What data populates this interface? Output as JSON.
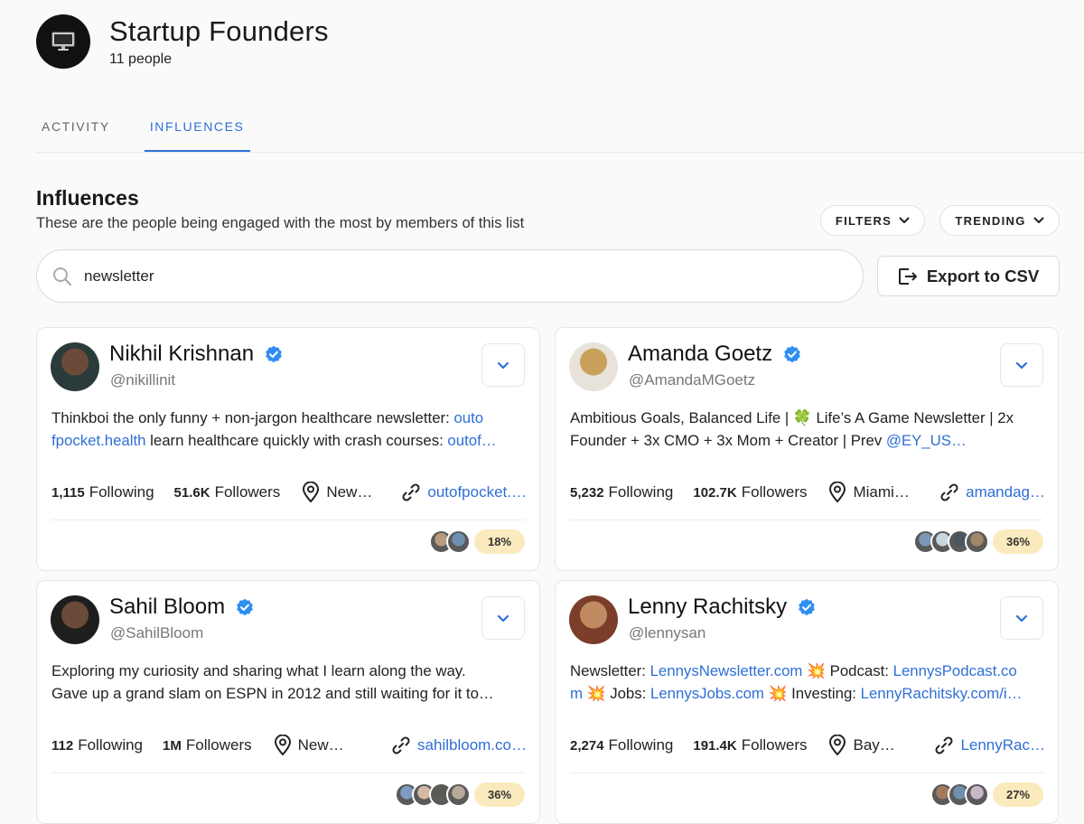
{
  "group": {
    "title": "Startup Founders",
    "count": "11 people",
    "icon": "monitor-icon"
  },
  "tabs": [
    {
      "label": "ACTIVITY",
      "active": false
    },
    {
      "label": "INFLUENCES",
      "active": true
    }
  ],
  "section": {
    "title": "Influences",
    "subtitle": "These are the people being engaged with the most by members of this list"
  },
  "controls": {
    "filters_label": "FILTERS",
    "trending_label": "TRENDING",
    "export_label": "Export to CSV"
  },
  "search": {
    "value": "newsletter",
    "placeholder": ""
  },
  "colors": {
    "accent": "#2f6fd6",
    "verified": "#2f8ef0",
    "pct_badge": "#fbeabd"
  },
  "people": [
    {
      "name": "Nikhil Krishnan",
      "handle": "@nikillinit",
      "bio_line1": [
        {
          "t": "Thinkboi the only funny + non-jargon healthcare newsletter: "
        },
        {
          "t": "outo",
          "link": true
        }
      ],
      "bio_line2": [
        {
          "t": "fpocket.health",
          "link": true
        },
        {
          "t": " learn healthcare quickly with crash courses: "
        },
        {
          "t": "outof…",
          "link": true
        }
      ],
      "following": "1,115",
      "following_label": "Following",
      "followers": "51.6K",
      "followers_label": "Followers",
      "location": "New…",
      "website": "outofpocket.…",
      "percent": "18%",
      "faces": [
        "#b89a7e",
        "#6f8fb0"
      ]
    },
    {
      "name": "Amanda Goetz",
      "handle": "@AmandaMGoetz",
      "bio_line1": [
        {
          "t": "Ambitious Goals, Balanced Life | 🍀 Life’s A Game Newsletter | 2x"
        }
      ],
      "bio_line2": [
        {
          "t": "Founder + 3x CMO + 3x Mom + Creator | Prev "
        },
        {
          "t": "@EY_US…",
          "link": true
        }
      ],
      "following": "5,232",
      "following_label": "Following",
      "followers": "102.7K",
      "followers_label": "Followers",
      "location": "Miami…",
      "website": "amandag…",
      "percent": "36%",
      "faces": [
        "#7d98b5",
        "#c9d6e0",
        "#4a5560",
        "#a08868"
      ]
    },
    {
      "name": "Sahil Bloom",
      "handle": "@SahilBloom",
      "bio_line1": [
        {
          "t": "Exploring my curiosity and sharing what I learn along the way."
        }
      ],
      "bio_line2": [
        {
          "t": "Gave up a grand slam on ESPN in 2012 and still waiting for it to…"
        }
      ],
      "following": "112",
      "following_label": "Following",
      "followers": "1M",
      "followers_label": "Followers",
      "location": "New…",
      "website": "sahilbloom.co…",
      "percent": "36%",
      "faces": [
        "#7f9cc0",
        "#d7b8a4",
        "#5b5a52",
        "#b7aa98"
      ]
    },
    {
      "name": "Lenny Rachitsky",
      "handle": "@lennysan",
      "bio_line1": [
        {
          "t": "Newsletter: "
        },
        {
          "t": "LennysNewsletter.com",
          "link": true
        },
        {
          "t": " 💥 Podcast: "
        },
        {
          "t": "LennysPodcast.co",
          "link": true
        }
      ],
      "bio_line2": [
        {
          "t": "m",
          "link": true
        },
        {
          "t": " 💥 Jobs: "
        },
        {
          "t": "LennysJobs.com",
          "link": true
        },
        {
          "t": " 💥 Investing: "
        },
        {
          "t": "LennyRachitsky.com/i…",
          "link": true
        }
      ],
      "following": "2,274",
      "following_label": "Following",
      "followers": "191.4K",
      "followers_label": "Followers",
      "location": "Bay…",
      "website": "LennyRac…",
      "percent": "27%",
      "faces": [
        "#a47a5c",
        "#6f8fb0",
        "#c8b7c4"
      ]
    }
  ]
}
